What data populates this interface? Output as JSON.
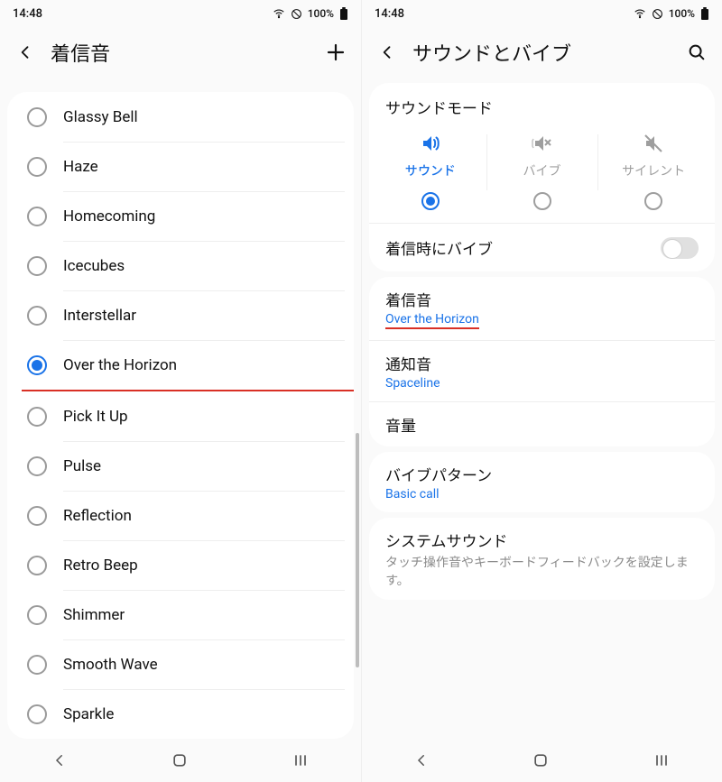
{
  "statusbar": {
    "time": "14:48",
    "battery_pct": "100%",
    "wifi_icon": "wifi-icon",
    "dnd_icon": "no-sign-icon",
    "battery_icon": "battery-full-icon"
  },
  "left": {
    "title": "着信音",
    "add_icon": "plus-icon",
    "back_icon": "back-icon",
    "ringtones": [
      {
        "label": "Glassy Bell",
        "selected": false
      },
      {
        "label": "Haze",
        "selected": false
      },
      {
        "label": "Homecoming",
        "selected": false
      },
      {
        "label": "Icecubes",
        "selected": false
      },
      {
        "label": "Interstellar",
        "selected": false
      },
      {
        "label": "Over the Horizon",
        "selected": true,
        "highlight": true
      },
      {
        "label": "Pick It Up",
        "selected": false
      },
      {
        "label": "Pulse",
        "selected": false
      },
      {
        "label": "Reflection",
        "selected": false
      },
      {
        "label": "Retro Beep",
        "selected": false
      },
      {
        "label": "Shimmer",
        "selected": false
      },
      {
        "label": "Smooth Wave",
        "selected": false
      },
      {
        "label": "Sparkle",
        "selected": false
      }
    ]
  },
  "right": {
    "title": "サウンドとバイブ",
    "search_icon": "search-icon",
    "back_icon": "back-icon",
    "sound_mode": {
      "heading": "サウンドモード",
      "options": [
        {
          "label": "サウンド",
          "icon": "speaker-icon",
          "selected": true
        },
        {
          "label": "バイブ",
          "icon": "vibrate-mute-icon",
          "selected": false
        },
        {
          "label": "サイレント",
          "icon": "mute-icon",
          "selected": false
        }
      ],
      "vibrate_on_ring_label": "着信時にバイブ",
      "vibrate_on_ring_on": false
    },
    "sound_settings": [
      {
        "title": "着信音",
        "sub": "Over the Horizon",
        "highlight": true
      },
      {
        "title": "通知音",
        "sub": "Spaceline"
      },
      {
        "title": "音量"
      }
    ],
    "vibe_pattern": {
      "title": "バイブパターン",
      "sub": "Basic call"
    },
    "system_sound": {
      "title": "システムサウンド",
      "desc": "タッチ操作音やキーボードフィードバックを設定します。"
    }
  },
  "nav": {
    "back": "back",
    "home": "home",
    "recents": "recents"
  }
}
